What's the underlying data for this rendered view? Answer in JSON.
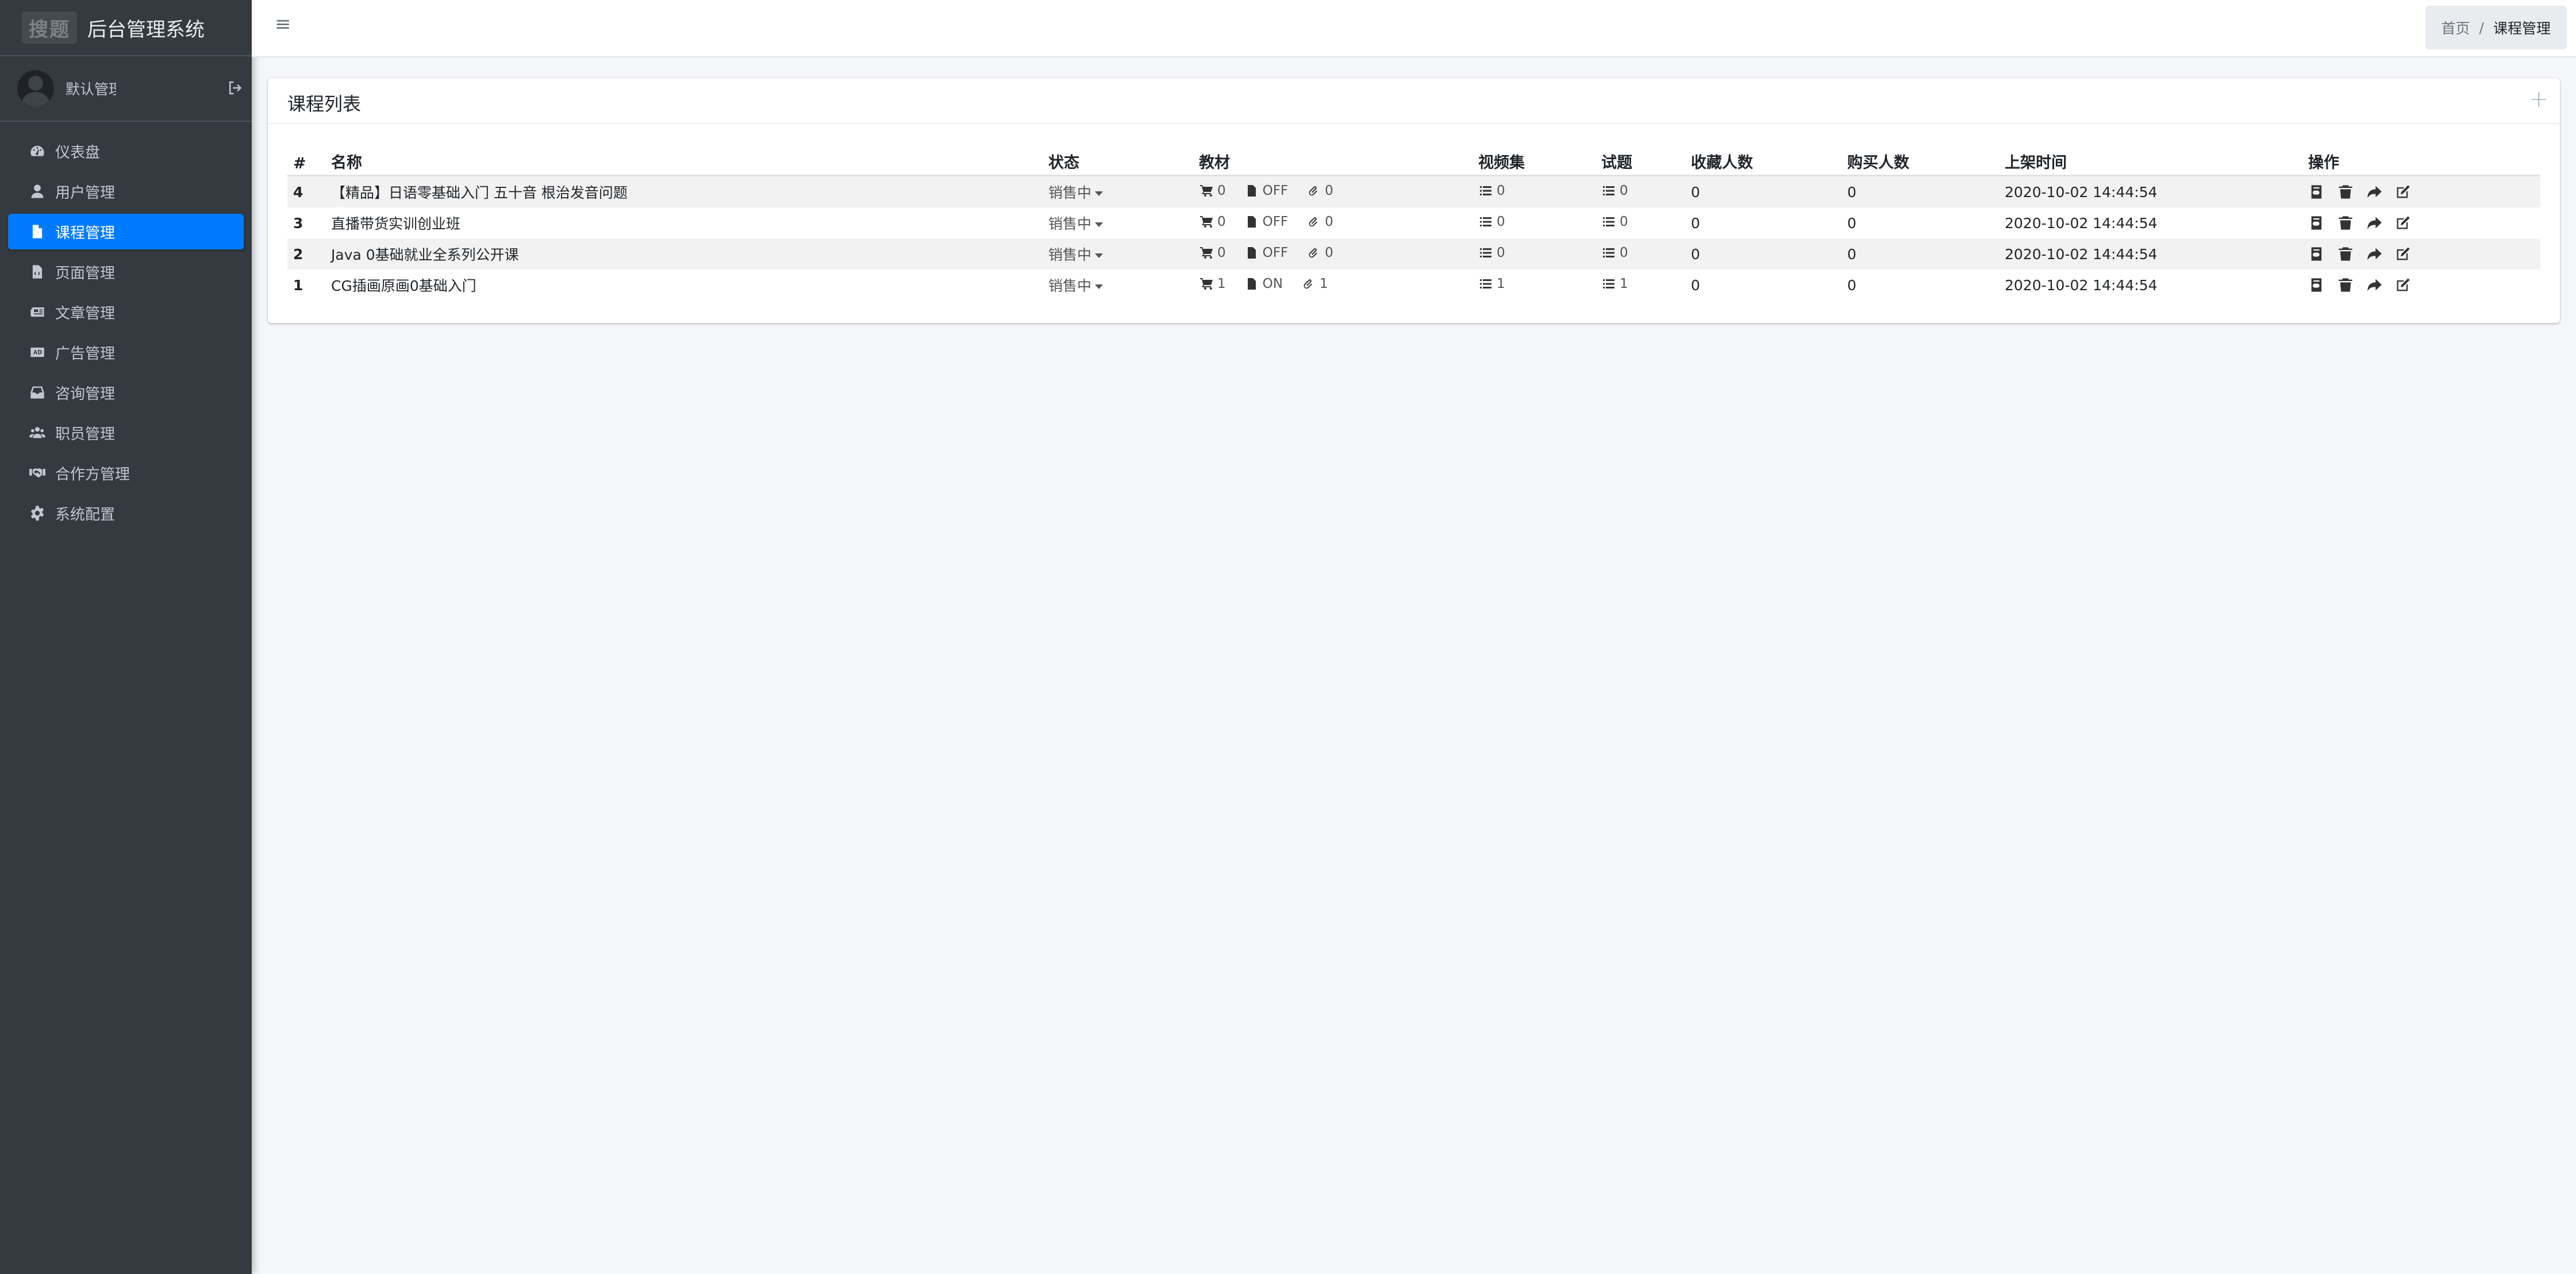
{
  "brand": {
    "logo": "搜题",
    "title": "后台管理系统"
  },
  "user": {
    "name": "默认管理员"
  },
  "sidebar": {
    "items": [
      {
        "label": "仪表盘",
        "icon": "dashboard-icon"
      },
      {
        "label": "用户管理",
        "icon": "user-icon"
      },
      {
        "label": "课程管理",
        "icon": "file-icon",
        "active": true
      },
      {
        "label": "页面管理",
        "icon": "file-code-icon"
      },
      {
        "label": "文章管理",
        "icon": "newspaper-icon"
      },
      {
        "label": "广告管理",
        "icon": "ad-icon"
      },
      {
        "label": "咨询管理",
        "icon": "inbox-icon"
      },
      {
        "label": "职员管理",
        "icon": "users-icon"
      },
      {
        "label": "合作方管理",
        "icon": "handshake-icon"
      },
      {
        "label": "系统配置",
        "icon": "gear-icon"
      }
    ]
  },
  "header": {
    "menu_icon": "≡",
    "breadcrumb": {
      "home": "首页",
      "separator": "/",
      "current": "课程管理"
    }
  },
  "card": {
    "title": "课程列表",
    "add_label": "+"
  },
  "table": {
    "columns": [
      "#",
      "名称",
      "状态",
      "教材",
      "视频集",
      "试题",
      "收藏人数",
      "购买人数",
      "上架时间",
      "操作"
    ],
    "rows": [
      {
        "id": "4",
        "name": "【精品】日语零基础入门 五十音 根治发音问题",
        "status": "销售中",
        "cart": "0",
        "file": "OFF",
        "attach": "0",
        "videos": "0",
        "questions": "0",
        "favorites": "0",
        "purchases": "0",
        "time": "2020-10-02 14:44:54"
      },
      {
        "id": "3",
        "name": "直播带货实训创业班",
        "status": "销售中",
        "cart": "0",
        "file": "OFF",
        "attach": "0",
        "videos": "0",
        "questions": "0",
        "favorites": "0",
        "purchases": "0",
        "time": "2020-10-02 14:44:54"
      },
      {
        "id": "2",
        "name": "Java 0基础就业全系列公开课",
        "status": "销售中",
        "cart": "0",
        "file": "OFF",
        "attach": "0",
        "videos": "0",
        "questions": "0",
        "favorites": "0",
        "purchases": "0",
        "time": "2020-10-02 14:44:54"
      },
      {
        "id": "1",
        "name": "CG插画原画0基础入门",
        "status": "销售中",
        "cart": "1",
        "file": "ON",
        "attach": "1",
        "videos": "1",
        "questions": "1",
        "favorites": "0",
        "purchases": "0",
        "time": "2020-10-02 14:44:54"
      }
    ]
  },
  "colors": {
    "sidebar_bg": "#343a40",
    "active": "#007bff",
    "page_bg": "#f4f6f9"
  }
}
